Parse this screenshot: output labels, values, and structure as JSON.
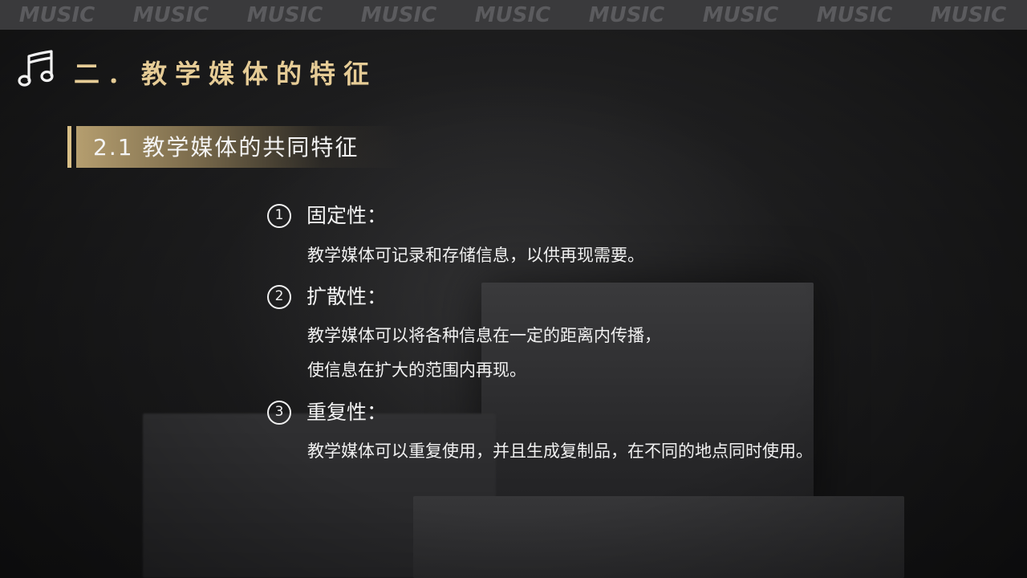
{
  "watermark": {
    "word": "MUSIC",
    "repeat": [
      "MUSIC",
      "MUSIC",
      "MUSIC",
      "MUSIC",
      "MUSIC",
      "MUSIC",
      "MUSIC",
      "MUSIC",
      "MUSIC"
    ]
  },
  "header": {
    "icon": "music-note-icon",
    "title": "二．教学媒体的特征"
  },
  "subheader": {
    "title": "2.1 教学媒体的共同特征"
  },
  "items": [
    {
      "number": "1",
      "title": "固定性：",
      "lines": [
        "教学媒体可记录和存储信息，以供再现需要。"
      ]
    },
    {
      "number": "2",
      "title": "扩散性：",
      "lines": [
        "教学媒体可以将各种信息在一定的距离内传播，",
        "使信息在扩大的范围内再现。"
      ]
    },
    {
      "number": "3",
      "title": "重复性：",
      "lines": [
        "教学媒体可以重复使用，并且生成复制品，在不同的地点同时使用。"
      ]
    }
  ],
  "colors": {
    "accent_gold": "#e6cc96",
    "background": "#1b1b1c",
    "top_band": "#3a3a3c"
  }
}
